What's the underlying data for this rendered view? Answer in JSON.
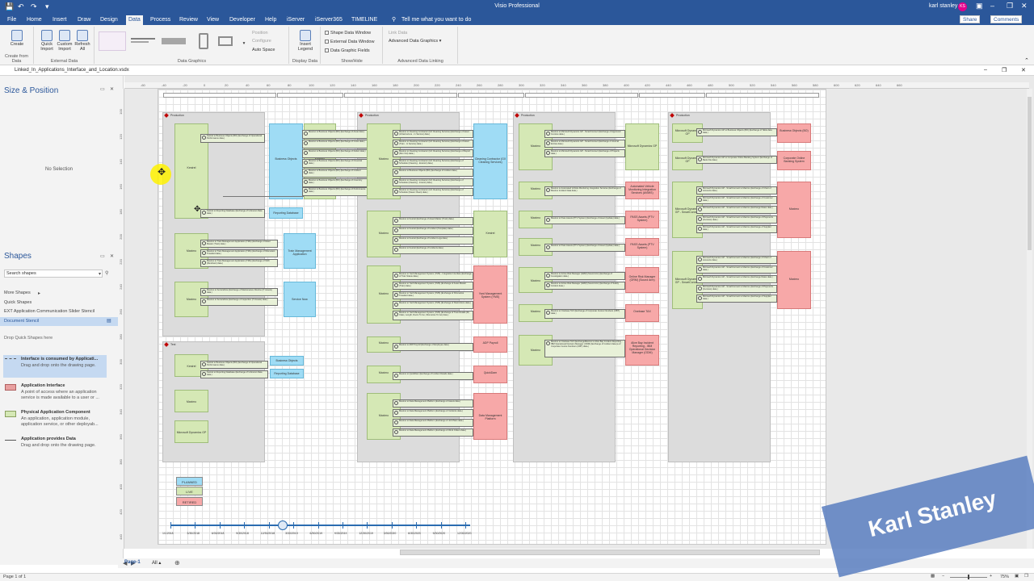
{
  "app": {
    "title": "Visio Professional",
    "user": "karl stanley",
    "initials": "KS"
  },
  "menu": {
    "tabs": [
      "File",
      "Home",
      "Insert",
      "Draw",
      "Design",
      "Data",
      "Process",
      "Review",
      "View",
      "Developer",
      "Help",
      "iServer",
      "iServer365",
      "TIMELINE"
    ],
    "active": "Data",
    "tell_me": "Tell me what you want to do",
    "share": "Share",
    "comments": "Comments"
  },
  "ribbon": {
    "create": "Create",
    "create_group": "Create from Data",
    "quick_import": "Quick Import",
    "custom_import": "Custom Import",
    "refresh_all": "Refresh All",
    "external_group": "External Data",
    "dg_group": "Data Graphics",
    "position": "Position",
    "configure": "Configure",
    "auto_space": "Auto Space",
    "insert_legend": "Insert Legend",
    "display_group": "Display Data",
    "shape_data_window": "Shape Data Window",
    "external_data_window": "External Data Window",
    "data_graphic_fields": "Data Graphic Fields",
    "showhide_group": "Show/Hide",
    "link_data": "Link Data",
    "advanced_dg": "Advanced Data Graphics",
    "adv_group": "Advanced Data Linking"
  },
  "document": {
    "filename": "Linked_In_Applications_Interface_and_Location.vsdx"
  },
  "size_position": {
    "title": "Size & Position",
    "empty": "No Selection"
  },
  "shapes": {
    "title": "Shapes",
    "search_placeholder": "Search shapes",
    "more_shapes": "More Shapes",
    "quick_shapes": "Quick Shapes",
    "stencils": [
      "EXT Application Communication Slider Stencil",
      "Document Stencil"
    ],
    "drop_hint": "Drop Quick Shapes here",
    "masters": [
      {
        "name": "Interface is consumed by Applicati...",
        "desc": "Drag and drop onto the drawing page."
      },
      {
        "name": "Application Interface",
        "desc": "A point of access where an application service is made available to a user or ..."
      },
      {
        "name": "Physical Application Component",
        "desc": "An application, application module, application service, or other deployab..."
      },
      {
        "name": "Application provides Data",
        "desc": "Drag and drop onto the drawing page."
      }
    ]
  },
  "canvas": {
    "ruler_h": [
      "-60",
      "-40",
      "-20",
      "0",
      "20",
      "40",
      "60",
      "80",
      "100",
      "120",
      "140",
      "160",
      "180",
      "200",
      "220",
      "240",
      "260",
      "280",
      "300",
      "320",
      "340",
      "360",
      "380",
      "400",
      "420",
      "440",
      "460",
      "480",
      "500",
      "520",
      "540",
      "560",
      "580",
      "600",
      "620",
      "640",
      "660"
    ],
    "ruler_v": [
      "100",
      "120",
      "140",
      "160",
      "180",
      "200",
      "220",
      "240",
      "260",
      "280",
      "300",
      "320",
      "340",
      "360",
      "380",
      "400",
      "420",
      "440"
    ],
    "zones": [
      {
        "label": "Production"
      },
      {
        "label": "Production"
      },
      {
        "label": "Production"
      },
      {
        "label": "Production"
      },
      {
        "label": "Test"
      }
    ],
    "apps": {
      "kestrel": "Kestrel",
      "business_objects": "Business Objects",
      "reporting_db": "Reporting Database",
      "maximo": "Maximo",
      "tms": "Train Management Application",
      "service_now": "Service Now",
      "cleaning": "Cleaning Contractor (GX Cleaning Services)",
      "yms": "Yard Management System (YMS)",
      "adp": "ADP Payroll",
      "quickdam": "QuickDam",
      "dms": "Data Management Platform",
      "ms_gp": "Microsoft Dynamics GP",
      "avis": "Automated Vehicle Monitoring Integration Services (AVMIS)",
      "pass": "PASS Assets (PTV System)",
      "orm": "Online Risk Manager (ORM) (Sound Arm)",
      "onebase": "Onebase TAX",
      "bo_rev": "Business Objects (BO)",
      "corp_bank": "Corporate Online Banking System",
      "ms_smart": "Microsoft Dynamics GP - SmartConnect",
      "incident": "Alive Bay Incident Reporting - IBM Operational Decision Manager (ODM)",
      "maximo_right": "Maximo"
    },
    "interfaces": {
      "k1": "Kestrel to Business Objects (BO) (Exchange of Operational Performance data.)",
      "k2": "Kestrel to Reporting Database (Exchange of Unknown Data data.)",
      "bo1": "Maximo to Business Objects (BO) (Exchange of Asset data.)",
      "bo2": "Maximo to Business Objects (BO) (Exchange of Costs data.)",
      "bo3": "Maximo to Business Objects (BO) (Exchange of Defect data.)",
      "bo4": "Maximo to Business Objects (BO) (Exchange of Financial data.)",
      "bo5": "Maximo to Business Objects (BO) (Exchange of Incident data.)",
      "bo6": "Maximo to Business Objects (BO) (Exchange of Inventory data.)",
      "bo7": "Maximo to Business Objects (BO) (Exchange of Performance data.)",
      "bo8": "Maximo to Business Objects (BO) (Exchange of Work Order data.)",
      "t1": "Maximo to Train Management Application (TMA) (Exchange of Asset Master (Train) data.)",
      "t2": "Maximo to Train Management Application (TMA) (Exchange of Kilometers Travelled data.)",
      "t3": "Maximo to Train Management Application (TMA) (Exchange of Shift (Rundown) data.)",
      "s1": "Maximo to ServiceNow (Exchange of Maintenance Routine (IT Assets) data.)",
      "s2": "Maximo to ServiceNow (Exchange of Inspection (IT Assets) data.)",
      "c1": "Maximo to Cleaning Contractor (GX Cleaning Services) (Exchange of Asset (Infrastructure - In Service) data.)",
      "c2": "Maximo to Cleaning Contractor (GX Cleaning Services) (Exchange of Asset (Train - In Service) data.)",
      "c3": "Maximo to Cleaning Contractor (GX Cleaning Services) (Exchange of Report (Run Out) data.)",
      "c4": "Maximo to Cleaning Contractor (GX Cleaning Services) (Exchange of Schedule (Cleaning - Exterior) data.)",
      "c5": "Maximo to Business Objects (BO) (Exchange of Incident data.)",
      "c6": "Maximo to Cleaning Contractor (GX Cleaning Services) (Exchange of Schedule (Cleaning - Interior) data.)",
      "c7": "Maximo to Cleaning Contractor (GX Cleaning Services) (Exchange of Schedule (Steam Clean) data.)",
      "m1": "Maximo to Kestrel (Exchange of Asset Master (Train) data.)",
      "m2": "Maximo to Kestrel (Exchange of Incident (Template) data.)",
      "m3": "Maximo to Kestrel (Exchange of Incident Logs data.)",
      "m4": "Maximo to Kestrel (Exchange of Incidents data.)",
      "y1": "Maximo to Yard Management System (YMS) - Integration Interface (Exchange of Train Status data.)",
      "y2": "Maximo to Yard Management System (YMS) (Exchange of Asset Master (Train) data.)",
      "y3": "Maximo to Yard Management System (YMS) (Exchange of Kilometres Travelled data.)",
      "y4": "Maximo to Yard Management System (YMS) (Exchange of Restrictions data.)",
      "y5": "Maximo to Yard Management System (YMS) (Exchange of Train Details (ID, Class, Length, Doors To Go, Kilometres To Go) data.)",
      "a1": "Maximo to ADP Payroll (Exchange of Employee data.)",
      "q1": "Maximo to QuickDam (Exchange of Incident Details data.)",
      "d1": "Maximo to Data Management Platform (Exchange of Assets data.)",
      "d2": "Maximo to Data Management Platform (Exchange of Incidents data.)",
      "d3": "Maximo to Data Management Platform (Exchange of Job Plans data.)",
      "d4": "Maximo to Data Management Platform (Exchange of Work Orders data.)",
      "g1": "Maximo to Microsoft Dynamics GP - SmartConnect (Exchange of Approved Invoices data.)",
      "g2": "Maximo to Microsoft Dynamics GP - SmartConnect (Exchange of Journal Entries data.)",
      "g3": "Maximo to Microsoft Dynamics GP - SmartConnect (Exchange of Projects data.)",
      "v1": "Maximo to Automated Vehicle Monitoring Integration Services (Exchange of Maximo Incident Data data.)",
      "p1": "Maximo to Pass Assets (PTV System) (Exchange of Asset (Update) data.)",
      "p2": "Maximo to Pass Assets (PTV System) (Exchange of Asset (Update) data.)",
      "o1": "Maximo to Active Risk Manager (ARM) (Sound Arm) (Exchange of Investigation data.)",
      "o2": "Maximo to Active Risk Manager (ARM) (Sound Arm) (Exchange of Safety Incident data.)",
      "x1": "Maximo to Onebase TAX (Exchange of Corporate Invoice Numbers (OBT) data.)",
      "i1": "Maximo to Onebase TAX (ExchangeMaximo to Alive Bay Incident Reporting - IBM Operational Decision Manager (ODM) (Exchange of Incident data.)a of Corporate Invoice Numbers (OBT) data.)",
      "r1": "Microsoft Dynamics GP to Business Objects (BO) (Exchange of Table data data.)",
      "r2": "Microsoft Dynamics GP to Corporate Online Banking System (Exchange of Bank File data.)",
      "r3": "Microsoft Dynamics GP - SmartConnect to Maximo (Exchange of Chart of Accounts data.)",
      "r4": "Microsoft Dynamics GP - SmartConnect to Maximo (Exchange of Customer data.)",
      "r5": "Microsoft Dynamics GP - SmartConnect to Maximo (Exchange Rates data.)",
      "r6": "Microsoft Dynamics GP - SmartConnect to Maximo (Exchange of Payments (Invoices) data.)",
      "r7": "Microsoft Dynamics GP - SmartConnect to Maximo (Exchange of Supplier data.)",
      "r8": "Microsoft Dynamics GP - SmartConnect to Maximo (Exchange of Chart of Accounts data.)",
      "r9": "Microsoft Dynamics GP - SmartConnect to Maximo (Exchange of Customer data.)",
      "r10": "Microsoft Dynamics GP - SmartConnect to Maximo (Exchange Rates data.)",
      "r11": "Microsoft Dynamics GP - SmartConnect to Maximo (Exchange of Payments (Invoices) data.)",
      "r12": "Microsoft Dynamics GP - SmartConnect to Maximo (Exchange of Supplier data.)",
      "tk1": "Kestrel to Business Objects (BO) (Exchange of Operational Performance data.)",
      "tk2": "Kestrel to Reporting Database (Exchange of Unknown Data data.)"
    },
    "test_apps": {
      "kestrel": "Kestrel",
      "bo": "Business Objects",
      "rdb": "Reporting Database",
      "maximo": "Maximo",
      "gp": "Microsoft Dynamics GP"
    },
    "legend": [
      "PLANNED",
      "LIVE",
      "RETIRED"
    ],
    "legend_colors": [
      "#9fdcf5",
      "#d5e8b5",
      "#f7a8a8"
    ],
    "timeline_dates": [
      "1/1/2018",
      "3/30/2018",
      "6/30/2018",
      "9/30/2018",
      "12/30/2018",
      "3/30/2019",
      "6/30/2019",
      "9/30/2019",
      "12/30/2019",
      "3/30/2020",
      "6/30/2020",
      "9/30/2020",
      "12/30/2020"
    ]
  },
  "pagetabs": {
    "page1": "Page-1",
    "all": "All"
  },
  "status": {
    "page": "Page 1 of 1",
    "zoom": "75%"
  },
  "watermark": "Karl Stanley"
}
